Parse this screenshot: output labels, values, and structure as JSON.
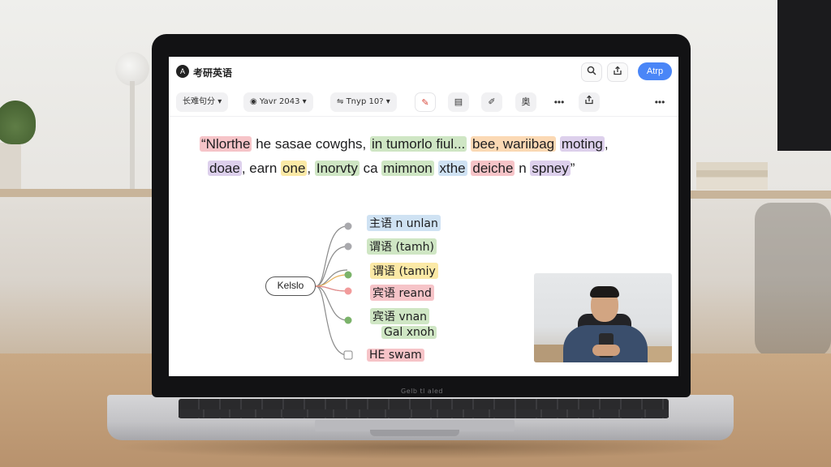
{
  "app": {
    "logo": "A",
    "title": "考研英语",
    "search_icon": "search-icon",
    "share_icon": "share-icon",
    "app_button": "Atrp"
  },
  "toolbar": {
    "mode_label": "长难句分",
    "view_label": "Yavr 2043",
    "layout_label": "Tnyp 10?",
    "extra_label": "奥"
  },
  "sentence": {
    "line1": [
      {
        "text": "“Nlorthe",
        "color": "red"
      },
      {
        "text": " he sasae cowghs, ",
        "color": "none"
      },
      {
        "text": "in tumorlo fiul...",
        "color": "green"
      },
      {
        "text": " ",
        "color": "none"
      },
      {
        "text": "bee, wariibag",
        "color": "orange"
      },
      {
        "text": " ",
        "color": "none"
      },
      {
        "text": "moting",
        "color": "purple"
      },
      {
        "text": ",",
        "color": "none"
      }
    ],
    "line2": [
      {
        "text": "doae",
        "color": "purple"
      },
      {
        "text": ", earn ",
        "color": "none"
      },
      {
        "text": "one",
        "color": "yellow"
      },
      {
        "text": ", ",
        "color": "none"
      },
      {
        "text": "Inorvty",
        "color": "green"
      },
      {
        "text": " ca ",
        "color": "none"
      },
      {
        "text": "mimnon",
        "color": "green"
      },
      {
        "text": " ",
        "color": "none"
      },
      {
        "text": "xthe",
        "color": "blue"
      },
      {
        "text": " ",
        "color": "none"
      },
      {
        "text": "deiche",
        "color": "red"
      },
      {
        "text": " n ",
        "color": "none"
      },
      {
        "text": "spney",
        "color": "purple"
      },
      {
        "text": "”",
        "color": "none"
      }
    ]
  },
  "mindmap": {
    "root": "Kelslo",
    "branches": [
      {
        "label": "主语 n unlan",
        "color": "blue"
      },
      {
        "label": "谓语 (tamh)",
        "color": "green"
      },
      {
        "label": "谓语 (tamiy",
        "color": "yellow"
      },
      {
        "label": "宾语 reand",
        "color": "orange"
      },
      {
        "label": "宾语 vnan",
        "color": "green"
      },
      {
        "label": "Gal xnoh",
        "color": "green"
      },
      {
        "label": "HE swam",
        "color": "red"
      }
    ]
  },
  "laptop": {
    "label": "Gelb tl aled"
  },
  "colors": {
    "accent": "#4a86f7",
    "red": "#f6c4c8",
    "blue": "#cfe2f3",
    "green": "#cfe6c4",
    "orange": "#fbd9b4",
    "purple": "#ddd0ec",
    "yellow": "#fbe9a6"
  }
}
